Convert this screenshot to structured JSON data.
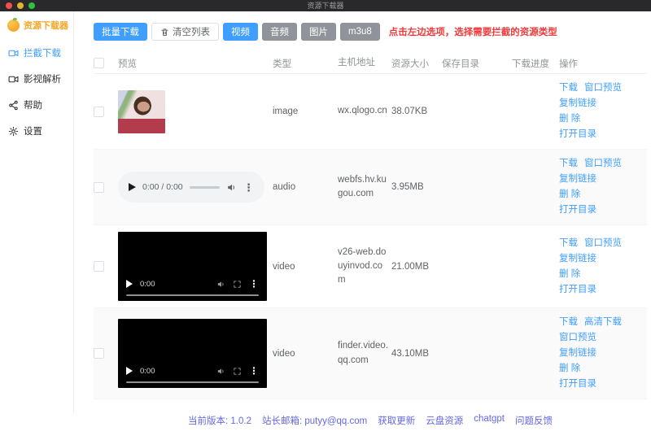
{
  "colors": {
    "primary": "#409eff",
    "info": "#909399",
    "danger": "#ee3a3a",
    "brand": "#f5a623",
    "purple": "#6467e2"
  },
  "window": {
    "title": "资源下载器"
  },
  "sidebar": {
    "logo_text": "资源下载器",
    "items": [
      {
        "id": "intercept-download",
        "label": "拦截下载",
        "icon": "video-camera-icon",
        "active": true
      },
      {
        "id": "media-parse",
        "label": "影视解析",
        "icon": "video-camera-icon",
        "active": false
      },
      {
        "id": "help",
        "label": "帮助",
        "icon": "share-icon",
        "active": false
      },
      {
        "id": "settings",
        "label": "设置",
        "icon": "gear-icon",
        "active": false
      }
    ]
  },
  "toolbar": {
    "batch_download": "批量下载",
    "clear_list": "清空列表",
    "clear_list_icon": "trash-icon",
    "filters": [
      {
        "id": "video",
        "label": "视频",
        "active": true
      },
      {
        "id": "audio",
        "label": "音频",
        "active": false
      },
      {
        "id": "image",
        "label": "图片",
        "active": false
      },
      {
        "id": "m3u8",
        "label": "m3u8",
        "active": false
      }
    ],
    "hint": "点击左边选项，选择需要拦截的资源类型"
  },
  "table": {
    "headers": [
      "预览",
      "类型",
      "主机地址",
      "资源大小",
      "保存目录",
      "下载进度",
      "操作"
    ],
    "rows": [
      {
        "preview": "image-thumbnail",
        "type": "image",
        "host": "wx.qlogo.cn",
        "size": "38.07KB",
        "save_dir": "",
        "progress": "",
        "action_lines": [
          [
            "下载",
            "窗口预览"
          ],
          [
            "复制链接"
          ],
          [
            "删 除"
          ],
          [
            "打开目录"
          ]
        ]
      },
      {
        "preview": "audio-player",
        "player_time": "0:00 / 0:00",
        "type": "audio",
        "host": "webfs.hv.kugou.com",
        "size": "3.95MB",
        "save_dir": "",
        "progress": "",
        "action_lines": [
          [
            "下载",
            "窗口预览"
          ],
          [
            "复制链接"
          ],
          [
            "删 除"
          ],
          [
            "打开目录"
          ]
        ]
      },
      {
        "preview": "video-player",
        "player_time": "0:00",
        "type": "video",
        "host": "v26-web.douyinvod.com",
        "size": "21.00MB",
        "save_dir": "",
        "progress": "",
        "action_lines": [
          [
            "下载",
            "窗口预览"
          ],
          [
            "复制链接"
          ],
          [
            "删 除"
          ],
          [
            "打开目录"
          ]
        ]
      },
      {
        "preview": "video-player",
        "player_time": "0:00",
        "type": "video",
        "host": "finder.video.qq.com",
        "size": "43.10MB",
        "save_dir": "",
        "progress": "",
        "action_lines": [
          [
            "下载",
            "高清下载"
          ],
          [
            "窗口预览"
          ],
          [
            "复制链接"
          ],
          [
            "删 除"
          ],
          [
            "打开目录"
          ]
        ]
      }
    ]
  },
  "footer": {
    "items": [
      {
        "text": "当前版本: 1.0.2",
        "link": false
      },
      {
        "text": "站长邮箱: putyy@qq.com",
        "link": false
      },
      {
        "text": "获取更新",
        "link": true
      },
      {
        "text": "云盘资源",
        "link": true
      },
      {
        "text": "chatgpt",
        "link": true
      },
      {
        "text": "问题反馈",
        "link": true
      }
    ]
  }
}
